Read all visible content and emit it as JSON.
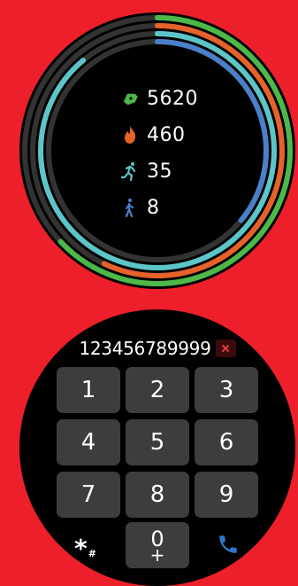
{
  "activity": {
    "steps": "5620",
    "calories": "460",
    "distance": "35",
    "active_minutes": "8",
    "icons": {
      "steps": "shoe-icon",
      "calories": "flame-icon",
      "distance": "running-icon",
      "active_minutes": "walking-icon"
    },
    "rings": [
      {
        "name": "steps",
        "color": "#4db848",
        "progress": 0.63
      },
      {
        "name": "calories",
        "color": "#e6622a",
        "progress": 0.57
      },
      {
        "name": "distance",
        "color": "#5cc5c8",
        "progress": 0.89
      },
      {
        "name": "active_minutes",
        "color": "#4a80c8",
        "progress": 0.36
      }
    ],
    "track_color": "#333333"
  },
  "dialer": {
    "number": "123456789999",
    "keys": {
      "k1": "1",
      "k2": "2",
      "k3": "3",
      "k4": "4",
      "k5": "5",
      "k6": "6",
      "k7": "7",
      "k8": "8",
      "k9": "9",
      "k0": "0",
      "k0_sub": "+"
    },
    "star": "*",
    "hash": "#",
    "clear_color": "#e23a3a",
    "call_color": "#2f76c9"
  },
  "background_color": "#ec1f2a"
}
